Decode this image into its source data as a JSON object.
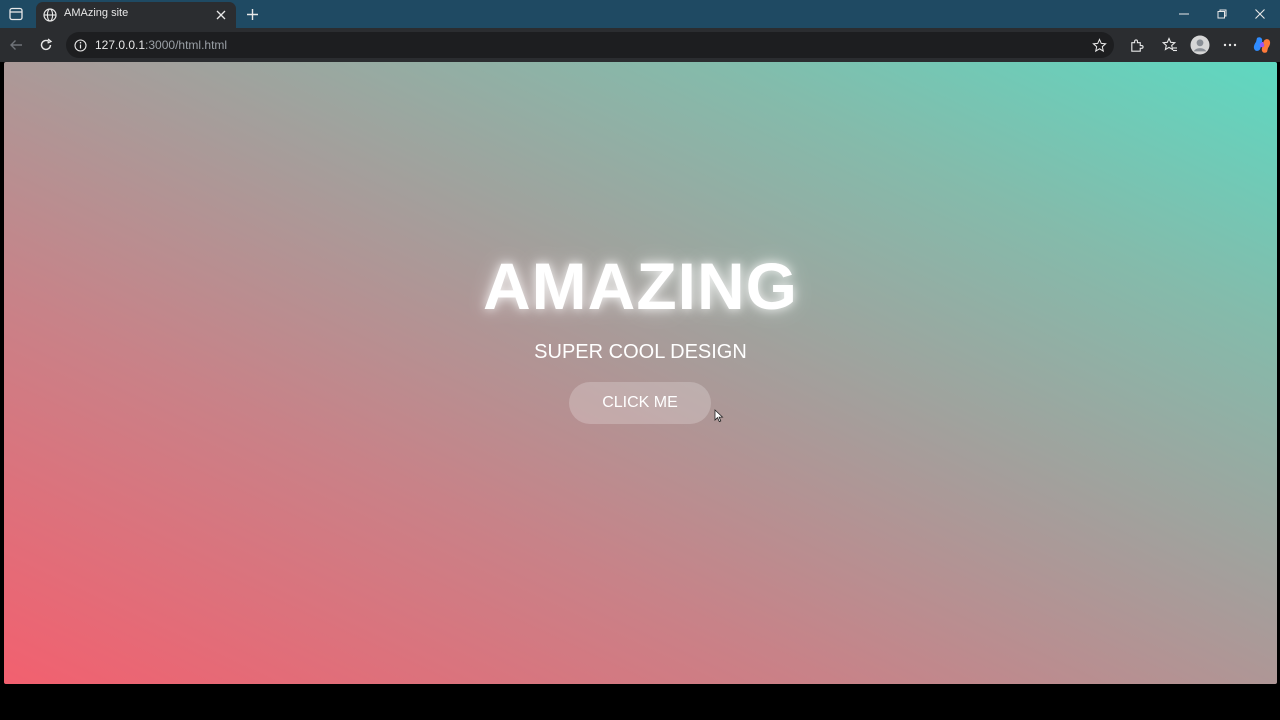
{
  "browser": {
    "tab": {
      "title": "AMAzing site",
      "favicon": "globe-icon"
    },
    "new_tab_icon": "plus-icon",
    "window_controls": [
      "minimize-icon",
      "restore-icon",
      "close-icon"
    ],
    "address_bar": {
      "host": "127.0.0.1",
      "path": ":3000/html.html"
    },
    "toolbar_icons": [
      "back-arrow-icon",
      "refresh-icon",
      "info-icon",
      "star-icon",
      "extensions-icon",
      "favorites-icon",
      "profile-avatar",
      "more-menu-icon",
      "copilot-icon"
    ]
  },
  "page": {
    "background_colors": [
      "#f2606f",
      "#a59e9b",
      "#5ed8c1"
    ],
    "title": "AMAZING",
    "subtitle": "SUPER COOL DESIGN",
    "button_label": "CLICK ME"
  }
}
